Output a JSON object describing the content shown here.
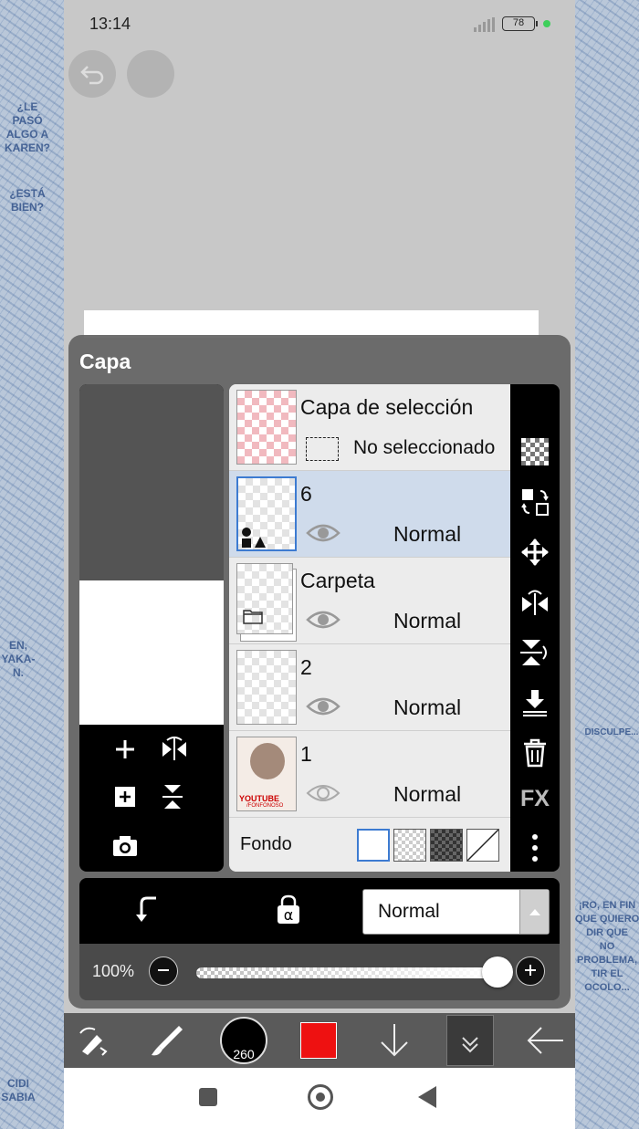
{
  "background_text": {
    "left_top": "¿LE\nPASÓ\nALGO A\nKAREN?",
    "left_mid": "¿ESTÁ\nBIEN?",
    "left_lower": "EN,\nYAKA-\nN.",
    "right_mid": "DISCULPE...",
    "right_lower": "¡RO, EN FIN\nQUE QUIERO\nDIR QUE\nNO\nPROBLEMA,\nTIR EL\nOCOLO...",
    "bottom_left": "CIDI\nSABIA"
  },
  "status_bar": {
    "time": "13:14",
    "battery": "78"
  },
  "panel": {
    "title": "Capa",
    "selection_layer": {
      "name": "Capa de selección",
      "status": "No seleccionado"
    },
    "layers": [
      {
        "name": "6",
        "blend": "Normal",
        "selected": true
      },
      {
        "name": "Carpeta",
        "blend": "Normal",
        "selected": false
      },
      {
        "name": "2",
        "blend": "Normal",
        "selected": false
      },
      {
        "name": "1",
        "blend": "Normal",
        "selected": false,
        "thumb_text": "YOUTUBE",
        "thumb_subtext": "/FONFONOSO"
      }
    ],
    "fondo_label": "Fondo",
    "blend_mode_value": "Normal",
    "opacity_label": "100%",
    "opacity_value": 100,
    "fx_label": "FX"
  },
  "toolbar": {
    "brush_size": "260",
    "color": "#ee1111"
  },
  "colors": {
    "selected_row": "#cfdbeb",
    "accent": "#3d7bd1"
  }
}
